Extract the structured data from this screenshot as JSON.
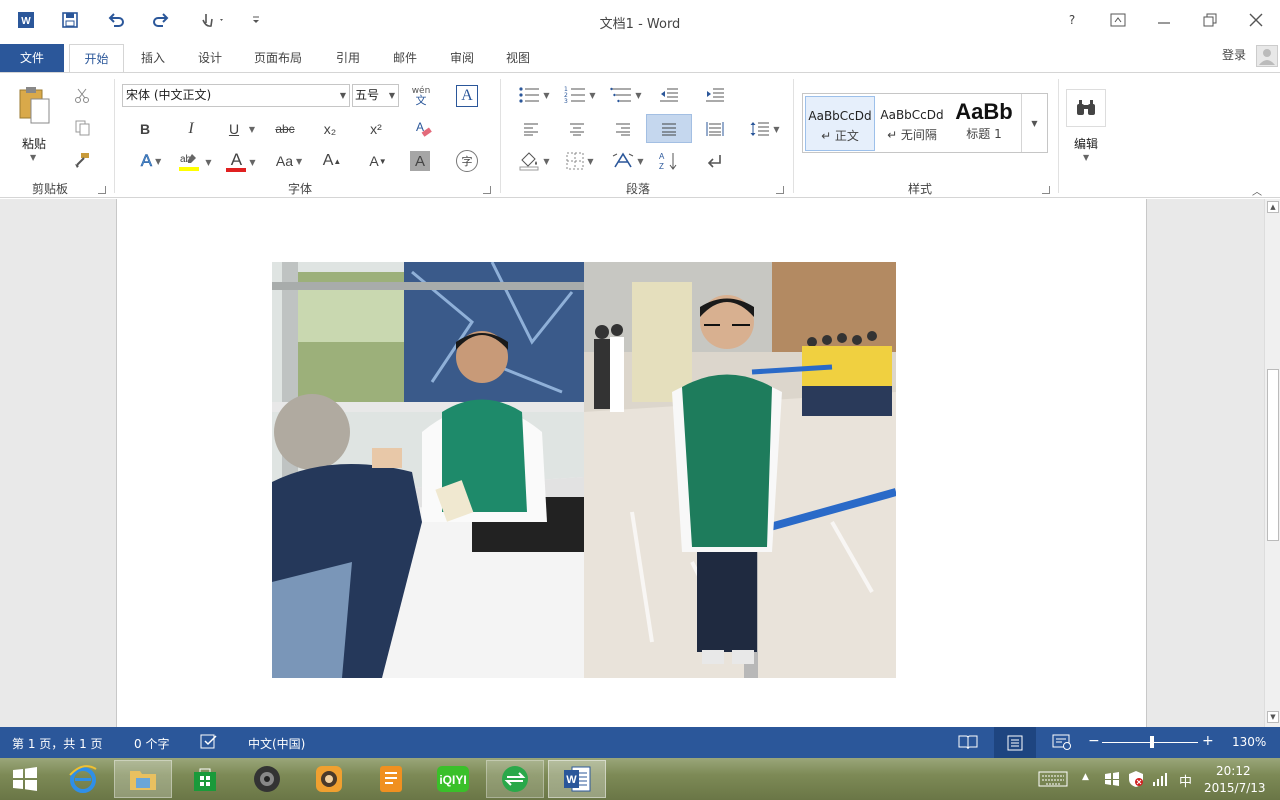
{
  "window": {
    "title": "文档1 - Word",
    "help": "?",
    "login": "登录"
  },
  "tabs": [
    "文件",
    "开始",
    "插入",
    "设计",
    "页面布局",
    "引用",
    "邮件",
    "审阅",
    "视图"
  ],
  "ribbon": {
    "groups": {
      "clipboard": "剪贴板",
      "font": "字体",
      "paragraph": "段落",
      "styles": "样式"
    },
    "paste_label": "粘贴",
    "edit_label": "编辑",
    "font_name": "宋体 (中文正文)",
    "font_size": "五号",
    "font_buttons": {
      "bold": "B",
      "italic": "I",
      "underline": "U",
      "strike": "abc",
      "subscript": "x₂",
      "superscript": "x²",
      "phonetic_top": "wén",
      "phonetic_bottom": "文",
      "border_char": "A",
      "text_effect": "A",
      "font_color": "A",
      "change_case": "Aa",
      "grow": "A",
      "shrink": "A",
      "shading": "A",
      "enclose": "字"
    },
    "styles": [
      {
        "preview": "AaBbCcDd",
        "name": "↵ 正文"
      },
      {
        "preview": "AaBbCcDd",
        "name": "↵ 无间隔"
      },
      {
        "preview": "AaBb",
        "name": "标题 1"
      }
    ]
  },
  "status": {
    "page": "第 1 页，共 1 页",
    "words": "0 个字",
    "language": "中文(中国)",
    "zoom": "130%",
    "zoom_minus": "−",
    "zoom_plus": "+"
  },
  "taskbar": {
    "ime": "中",
    "time": "20:12",
    "date": "2015/7/13"
  },
  "colors": {
    "accent": "#2b579a",
    "highlight": "#ffff00",
    "font_color": "#e02020"
  }
}
